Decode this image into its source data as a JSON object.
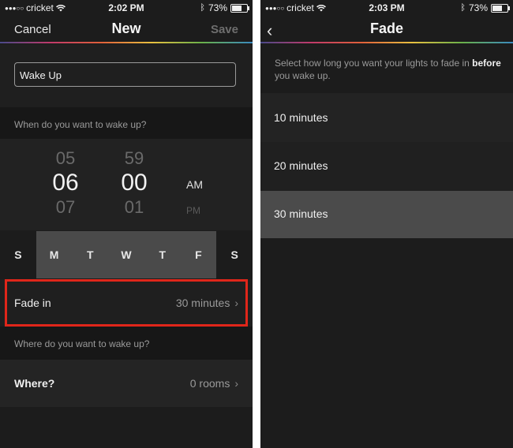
{
  "left": {
    "status": {
      "carrier": "cricket",
      "time": "2:02 PM",
      "battery": "73%",
      "battery_level": 0.73
    },
    "nav": {
      "cancel": "Cancel",
      "title": "New",
      "save": "Save"
    },
    "name_value": "Wake Up",
    "when_label": "When do you want to wake up?",
    "picker": {
      "hour_prev": "05",
      "hour": "06",
      "hour_next": "07",
      "min_prev": "59",
      "min": "00",
      "min_next": "01",
      "ampm": "AM",
      "ampm_next": "PM"
    },
    "days": [
      {
        "label": "S",
        "selected": false
      },
      {
        "label": "M",
        "selected": true
      },
      {
        "label": "T",
        "selected": true
      },
      {
        "label": "W",
        "selected": true
      },
      {
        "label": "T",
        "selected": true
      },
      {
        "label": "F",
        "selected": true
      },
      {
        "label": "S",
        "selected": false
      }
    ],
    "fade_in": {
      "label": "Fade in",
      "value": "30 minutes"
    },
    "where_label": "Where do you want to wake up?",
    "where": {
      "label": "Where?",
      "value": "0 rooms"
    }
  },
  "right": {
    "status": {
      "carrier": "cricket",
      "time": "2:03 PM",
      "battery": "73%",
      "battery_level": 0.73
    },
    "nav": {
      "title": "Fade"
    },
    "description_pre": "Select how long you want your lights to fade in",
    "description_bold": "before",
    "description_post": "you wake up.",
    "options": [
      {
        "label": "10 minutes",
        "selected": false
      },
      {
        "label": "20 minutes",
        "selected": false
      },
      {
        "label": "30 minutes",
        "selected": true
      }
    ]
  }
}
